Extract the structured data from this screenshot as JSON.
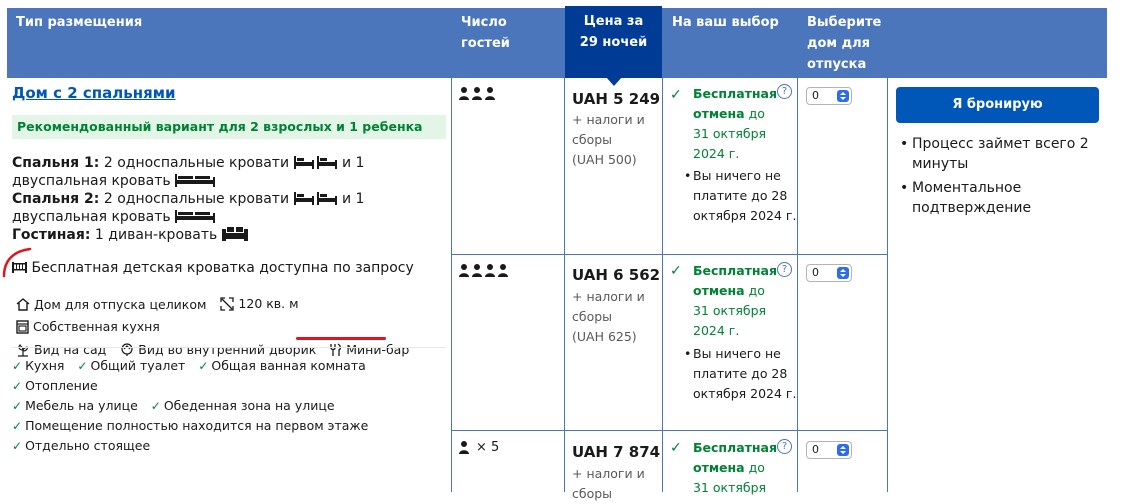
{
  "columns": {
    "type": "Тип размещения",
    "guests": "Число гостей",
    "price": "Цена за 29 ночей",
    "choice": "На ваш выбор",
    "select": "Выберите дом для отпуска"
  },
  "room": {
    "name": "Дом с 2 спальнями",
    "recommended": "Рекомендованный вариант для 2 взрослых и 1 ребенка",
    "bedroom1_label": "Спальня 1:",
    "bedroom1_text": " 2 односпальные кровати ",
    "bedroom1_text2": " и 1 двуспальная кровать ",
    "bedroom2_label": "Спальня 2:",
    "bedroom2_text": " 2 односпальные кровати ",
    "bedroom2_text2": " и 1 двуспальная кровать ",
    "living_label": "Гостиная:",
    "living_text": " 1 диван-кровать ",
    "crib": "Бесплатная детская кроватка доступна по запросу",
    "facilities": [
      "Дом для отпуска целиком",
      "120 кв. м",
      "Собственная кухня",
      "Вид на сад",
      "Вид во внутренний дворик",
      "Мини-бар"
    ],
    "amenities": [
      "Кухня",
      "Общий туалет",
      "Общая ванная комната",
      "Отопление",
      "Мебель на улице",
      "Обеденная зона на улице",
      "Помещение полностью находится на первом этаже",
      "Отдельно стоящее"
    ]
  },
  "options": [
    {
      "guests_count_text": "",
      "price": "UAH 5 249",
      "tax_line1": "+ налоги и",
      "tax_line2": "сборы",
      "tax_amount": "(UAH 500)",
      "free_cancel1": "Бесплатная",
      "free_cancel2": "отмена",
      "free_cancel3": " до",
      "free_date1": "31 октября",
      "free_date2": "2024 г.",
      "pay_note": "Вы ничего не платите до 28 октября 2024 г.",
      "select_value": "0"
    },
    {
      "guests_count_text": "",
      "price": "UAH 6 562",
      "tax_line1": "+ налоги и",
      "tax_line2": "сборы",
      "tax_amount": "(UAH 625)",
      "free_cancel1": "Бесплатная",
      "free_cancel2": "отмена",
      "free_cancel3": " до",
      "free_date1": "31 октября",
      "free_date2": "2024 г.",
      "pay_note": "Вы ничего не платите до 28 октября 2024 г.",
      "select_value": "0"
    },
    {
      "guests_count_text": "× 5",
      "price": "UAH 7 874",
      "tax_line1": "+ налоги и",
      "tax_line2": "сборы",
      "free_cancel1": "Бесплатная",
      "free_cancel2": "отмена",
      "free_cancel3": " до",
      "free_date1": "31 октября",
      "select_value": "0"
    }
  ],
  "sidebar": {
    "book_button": "Я бронирую",
    "bullets": [
      "Процесс займет всего 2 минуты",
      "Моментальное подтверждение"
    ]
  },
  "colors": {
    "header_bg": "#4b76bb",
    "price_header_bg": "#003b95",
    "link": "#0057b8",
    "green": "#008234",
    "annotation": "#e0141e"
  }
}
